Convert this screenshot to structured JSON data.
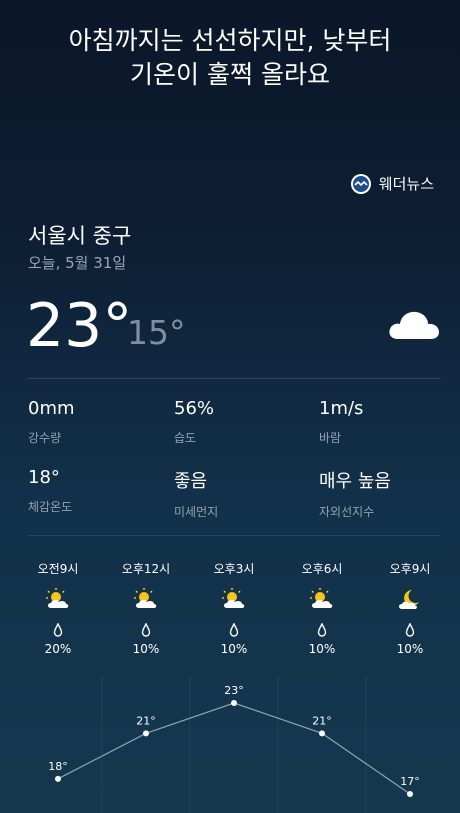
{
  "headline": {
    "line1": "아침까지는 선선하지만, 낮부터",
    "line2": "기온이 훌쩍 올라요"
  },
  "brand": {
    "name": "웨더뉴스",
    "icon": "weathernews-logo-icon"
  },
  "location": "서울시 중구",
  "date": "오늘, 5월 31일",
  "current": {
    "temp": "23°",
    "low": "15°",
    "icon": "cloud-icon"
  },
  "metrics": [
    {
      "value": "0mm",
      "label": "강수량"
    },
    {
      "value": "56%",
      "label": "습도"
    },
    {
      "value": "1m/s",
      "label": "바람"
    },
    {
      "value": "18°",
      "label": "체감온도"
    },
    {
      "value": "좋음",
      "label": "미세먼지"
    },
    {
      "value": "매우 높음",
      "label": "자외선지수"
    }
  ],
  "hourly": [
    {
      "time": "오전9시",
      "icon": "partly-sunny-icon",
      "precip": "20%",
      "temp_label": "18°",
      "temp": 18
    },
    {
      "time": "오후12시",
      "icon": "partly-sunny-icon",
      "precip": "10%",
      "temp_label": "21°",
      "temp": 21
    },
    {
      "time": "오후3시",
      "icon": "partly-sunny-icon",
      "precip": "10%",
      "temp_label": "23°",
      "temp": 23
    },
    {
      "time": "오후6시",
      "icon": "partly-sunny-icon",
      "precip": "10%",
      "temp_label": "21°",
      "temp": 21
    },
    {
      "time": "오후9시",
      "icon": "partly-cloudy-night-icon",
      "precip": "10%",
      "temp_label": "17°",
      "temp": 17
    }
  ],
  "colors": {
    "sun": "#f5c518",
    "cloud": "#ffffff",
    "line": "#8fa3b6",
    "muted": "#93a1b0"
  }
}
